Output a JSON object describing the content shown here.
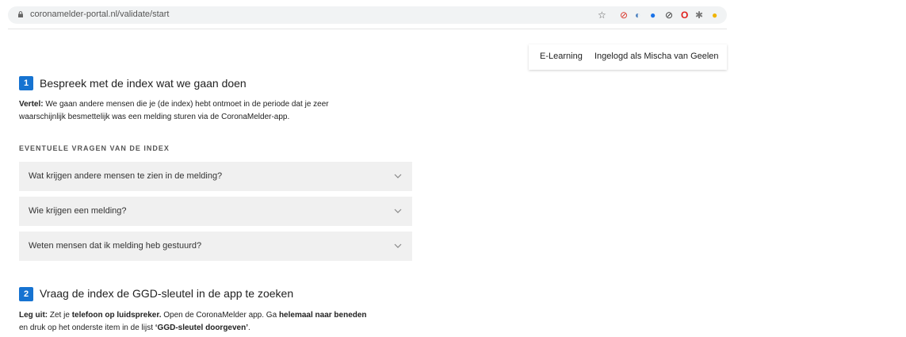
{
  "browser": {
    "url": "coronamelder-portal.nl/validate/start"
  },
  "nav": {
    "elearning": "E-Learning",
    "user": "Ingelogd als Mischa van Geelen"
  },
  "step1": {
    "number": "1",
    "title": "Bespreek met de index wat we gaan doen",
    "tell_label": "Vertel:",
    "tell_text_1": " We gaan andere mensen die je (de index) hebt ontmoet in de periode dat je zeer",
    "tell_text_2": "waarschijnlijk besmettelijk was een melding sturen via de CoronaMelder-app."
  },
  "questions": {
    "label": "EVENTUELE VRAGEN VAN DE INDEX",
    "items": [
      {
        "text": "Wat krijgen andere mensen te zien in de melding?"
      },
      {
        "text": "Wie krijgen een melding?"
      },
      {
        "text": "Weten mensen dat ik melding heb gestuurd?"
      }
    ]
  },
  "step2": {
    "number": "2",
    "title": "Vraag de index de GGD-sleutel in de app te zoeken",
    "explain_label": "Leg uit:",
    "t1": " Zet je ",
    "b1": "telefoon op luidspreker.",
    "t2": " Open de CoronaMelder app. Ga ",
    "b2": "helemaal naar beneden",
    "t3": "en druk op het onderste item in de lijst ",
    "b3": "‘GGD-sleutel doorgeven’",
    "t4": "."
  },
  "colors": {
    "accent": "#1673d1",
    "accordion_bg": "#f0f0f0"
  }
}
